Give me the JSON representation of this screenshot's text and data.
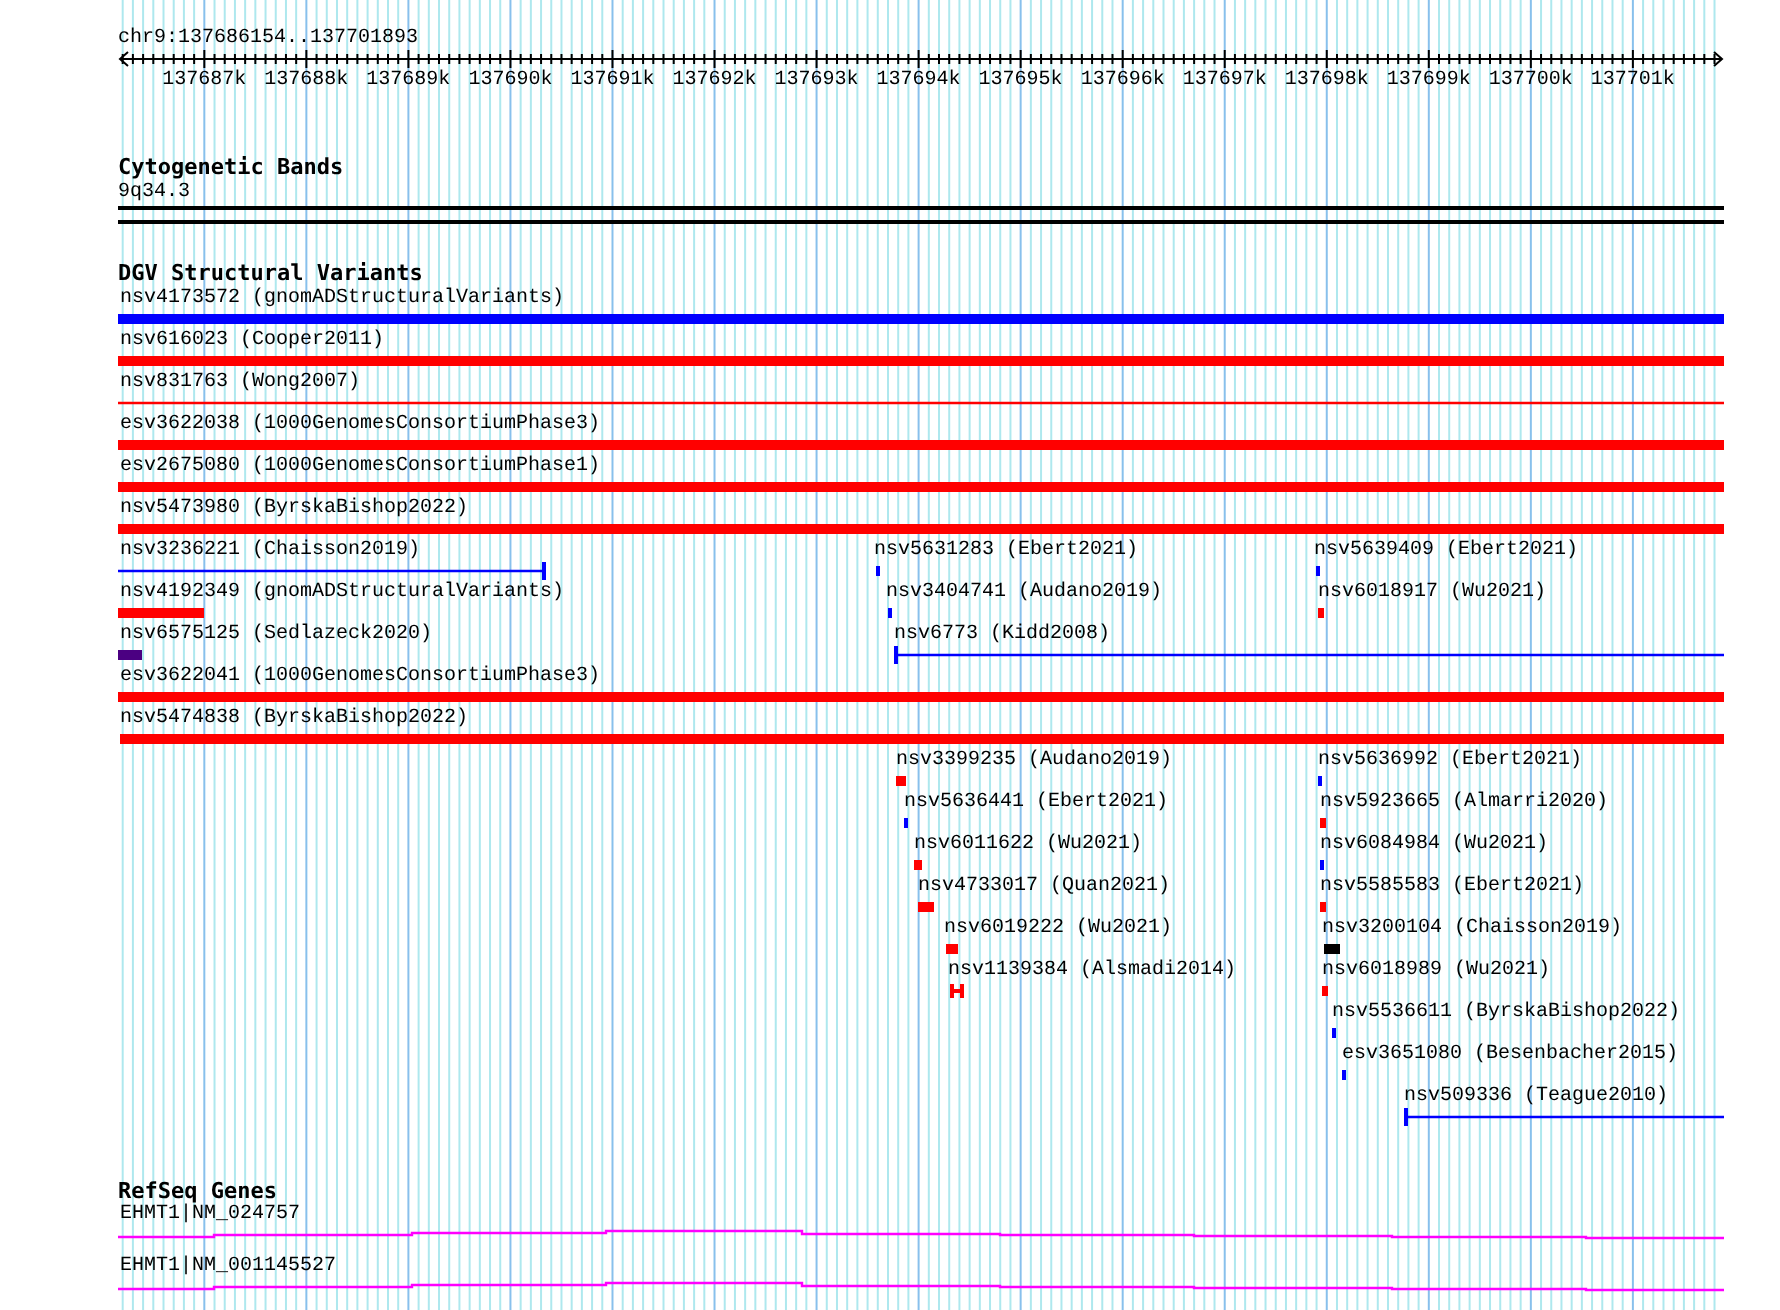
{
  "location": "chr9:137686154..137701893",
  "ruler": {
    "ticks": [
      "137687k",
      "137688k",
      "137689k",
      "137690k",
      "137691k",
      "137692k",
      "137693k",
      "137694k",
      "137695k",
      "137696k",
      "137697k",
      "137698k",
      "137699k",
      "137700k",
      "137701k"
    ]
  },
  "cytogenetic_bands": {
    "title": "Cytogenetic Bands",
    "band": "9q34.3"
  },
  "structural_variants": {
    "title": "DGV Structural Variants",
    "rows": [
      [
        {
          "label": "nsv4173572 (gnomADStructuralVariants)",
          "kind": "bar",
          "color": "#0000ff"
        }
      ],
      [
        {
          "label": "nsv616023 (Cooper2011)",
          "kind": "bar",
          "color": "#ff0000"
        }
      ],
      [
        {
          "label": "nsv831763 (Wong2007)",
          "kind": "line",
          "color": "#ff0000"
        }
      ],
      [
        {
          "label": "esv3622038 (1000GenomesConsortiumPhase3)",
          "kind": "bar",
          "color": "#ff0000"
        }
      ],
      [
        {
          "label": "esv2675080 (1000GenomesConsortiumPhase1)",
          "kind": "bar",
          "color": "#ff0000"
        }
      ],
      [
        {
          "label": "nsv5473980 (ByrskaBishop2022)",
          "kind": "bar",
          "color": "#ff0000"
        }
      ],
      [
        {
          "label": "nsv3236221 (Chaisson2019)",
          "kind": "line",
          "color": "#0000ff"
        },
        {
          "label": "nsv5631283 (Ebert2021)",
          "kind": "bar",
          "color": "#0000ff"
        },
        {
          "label": "nsv5639409 (Ebert2021)",
          "kind": "bar",
          "color": "#0000ff"
        }
      ],
      [
        {
          "label": "nsv4192349 (gnomADStructuralVariants)",
          "kind": "bar",
          "color": "#ff0000"
        },
        {
          "label": "nsv3404741 (Audano2019)",
          "kind": "bar",
          "color": "#0000ff"
        },
        {
          "label": "nsv6018917 (Wu2021)",
          "kind": "bar",
          "color": "#ff0000"
        }
      ],
      [
        {
          "label": "nsv6575125 (Sedlazeck2020)",
          "kind": "bar",
          "color": "#4b0082"
        },
        {
          "label": "nsv6773 (Kidd2008)",
          "kind": "line",
          "color": "#0000ff"
        }
      ],
      [
        {
          "label": "esv3622041 (1000GenomesConsortiumPhase3)",
          "kind": "bar",
          "color": "#ff0000"
        }
      ],
      [
        {
          "label": "nsv5474838 (ByrskaBishop2022)",
          "kind": "bar",
          "color": "#ff0000"
        }
      ],
      [
        {
          "label": "nsv3399235 (Audano2019)",
          "kind": "bar",
          "color": "#ff0000"
        },
        {
          "label": "nsv5636992 (Ebert2021)",
          "kind": "bar",
          "color": "#0000ff"
        }
      ],
      [
        {
          "label": "nsv5636441 (Ebert2021)",
          "kind": "bar",
          "color": "#0000ff"
        },
        {
          "label": "nsv5923665 (Almarri2020)",
          "kind": "bar",
          "color": "#ff0000"
        }
      ],
      [
        {
          "label": "nsv6011622 (Wu2021)",
          "kind": "bar",
          "color": "#ff0000"
        },
        {
          "label": "nsv6084984 (Wu2021)",
          "kind": "bar",
          "color": "#0000ff"
        }
      ],
      [
        {
          "label": "nsv4733017 (Quan2021)",
          "kind": "bar",
          "color": "#ff0000"
        },
        {
          "label": "nsv5585583 (Ebert2021)",
          "kind": "bar",
          "color": "#ff0000"
        }
      ],
      [
        {
          "label": "nsv6019222 (Wu2021)",
          "kind": "bar",
          "color": "#ff0000"
        },
        {
          "label": "nsv3200104 (Chaisson2019)",
          "kind": "bar",
          "color": "#000000"
        }
      ],
      [
        {
          "label": "nsv1139384 (Alsmadi2014)",
          "kind": "bracket",
          "color": "#ff0000"
        },
        {
          "label": "nsv6018989 (Wu2021)",
          "kind": "bar",
          "color": "#ff0000"
        }
      ],
      [
        {
          "label": "nsv5536611 (ByrskaBishop2022)",
          "kind": "bar",
          "color": "#0000ff"
        }
      ],
      [
        {
          "label": "esv3651080 (Besenbacher2015)",
          "kind": "bar",
          "color": "#0000ff"
        }
      ],
      [
        {
          "label": "nsv509336 (Teague2010)",
          "kind": "line",
          "color": "#0000ff"
        }
      ]
    ]
  },
  "refseq_genes": {
    "title": "RefSeq Genes",
    "genes": [
      {
        "label": "EHMT1|NM_024757"
      },
      {
        "label": "EHMT1|NM_001145527"
      }
    ]
  }
}
